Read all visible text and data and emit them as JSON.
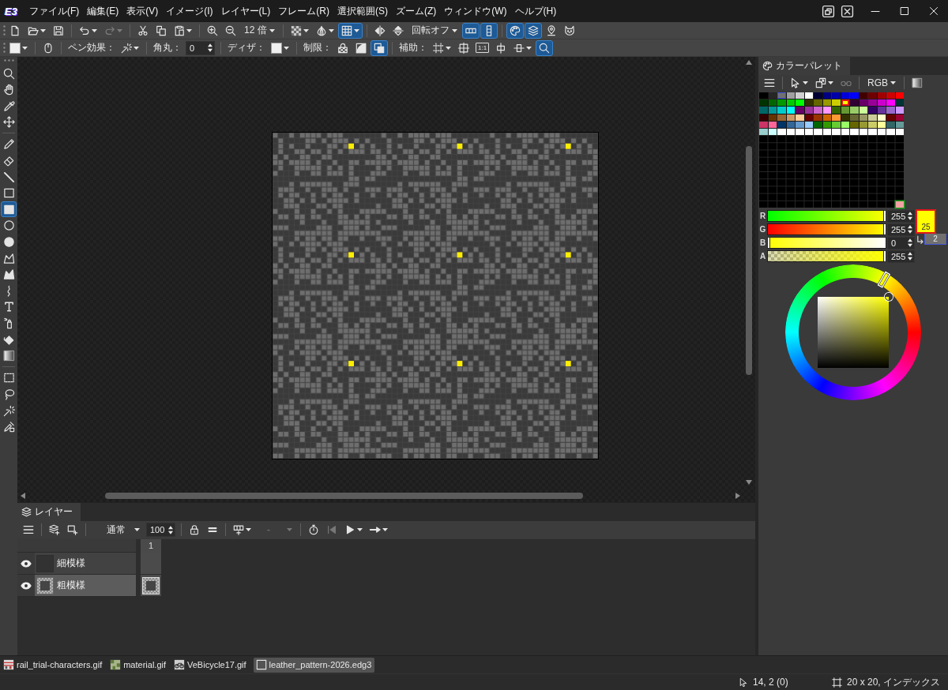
{
  "logo": "E3",
  "menu": [
    "ファイル(F)",
    "編集(E)",
    "表示(V)",
    "イメージ(I)",
    "レイヤー(L)",
    "フレーム(R)",
    "選択範囲(S)",
    "ズーム(Z)",
    "ウィンドウ(W)",
    "ヘルプ(H)"
  ],
  "main_toolbar": {
    "groups": [
      [
        {
          "kind": "icon",
          "on": false,
          "disabled": false,
          "dropdown": false
        },
        {
          "kind": "icon",
          "on": false,
          "disabled": false,
          "dropdown": true
        },
        {
          "kind": "icon",
          "on": false,
          "disabled": false,
          "dropdown": false
        }
      ],
      [
        {
          "kind": "icon",
          "on": false,
          "disabled": false,
          "dropdown": true
        },
        {
          "kind": "icon",
          "on": false,
          "disabled": true,
          "dropdown": true
        }
      ],
      [
        {
          "kind": "icon",
          "on": false,
          "disabled": false,
          "dropdown": false
        },
        {
          "kind": "icon",
          "on": false,
          "disabled": false,
          "dropdown": false
        },
        {
          "kind": "icon",
          "on": false,
          "disabled": false,
          "dropdown": true
        }
      ],
      [
        {
          "kind": "icon",
          "on": false,
          "disabled": false,
          "dropdown": false
        },
        {
          "kind": "icon",
          "on": false,
          "disabled": false,
          "dropdown": false
        },
        {
          "kind": "label",
          "label": "12 倍",
          "on": false,
          "disabled": false,
          "dropdown": true
        }
      ],
      [
        {
          "kind": "icon",
          "on": false,
          "disabled": false,
          "dropdown": true
        },
        {
          "kind": "icon",
          "on": false,
          "disabled": false,
          "dropdown": true
        },
        {
          "kind": "icon",
          "on": true,
          "disabled": false,
          "dropdown": true
        }
      ],
      [
        {
          "kind": "icon",
          "on": false,
          "disabled": false,
          "dropdown": false
        },
        {
          "kind": "icon",
          "on": false,
          "disabled": false,
          "dropdown": false
        },
        {
          "kind": "label",
          "label": "回転オフ",
          "on": false,
          "disabled": false,
          "dropdown": true
        },
        {
          "kind": "icon",
          "on": true,
          "disabled": false,
          "dropdown": false
        },
        {
          "kind": "icon",
          "on": true,
          "disabled": false,
          "dropdown": false
        }
      ],
      [
        {
          "kind": "icon",
          "on": true,
          "disabled": false,
          "dropdown": false
        },
        {
          "kind": "icon",
          "on": true,
          "disabled": false,
          "dropdown": false
        },
        {
          "kind": "icon",
          "on": false,
          "disabled": false,
          "dropdown": false
        },
        {
          "kind": "icon",
          "on": false,
          "disabled": false,
          "dropdown": false
        }
      ]
    ]
  },
  "options_toolbar": {
    "groups": [
      [
        {
          "kind": "swatch",
          "color": "#f0f0f0",
          "dropdown": true
        }
      ],
      [
        {
          "kind": "icon",
          "on": false,
          "dropdown": false
        }
      ],
      [
        {
          "kind": "text",
          "label": "ペン効果："
        },
        {
          "kind": "icon",
          "on": false,
          "dropdown": true
        }
      ],
      [
        {
          "kind": "text",
          "label": "角丸："
        },
        {
          "kind": "field",
          "value": "0"
        }
      ],
      [
        {
          "kind": "text",
          "label": "ディザ："
        },
        {
          "kind": "swatch",
          "color": "#f0f0f0",
          "dropdown": true
        }
      ],
      [
        {
          "kind": "text",
          "label": "制限："
        },
        {
          "kind": "icon",
          "on": false,
          "dropdown": false
        },
        {
          "kind": "icon",
          "on": false,
          "dropdown": false
        },
        {
          "kind": "icon",
          "on": true,
          "dropdown": false
        }
      ],
      [
        {
          "kind": "text",
          "label": "補助："
        },
        {
          "kind": "icon",
          "on": false,
          "dropdown": true
        },
        {
          "kind": "icon",
          "on": false,
          "dropdown": false
        },
        {
          "kind": "badge",
          "label": "1:1",
          "on": false
        },
        {
          "kind": "icon",
          "on": false,
          "dropdown": false
        },
        {
          "kind": "icon",
          "on": false,
          "dropdown": true
        },
        {
          "kind": "icon",
          "on": true,
          "dropdown": false
        }
      ]
    ]
  },
  "toolbox": {
    "groups": [
      [
        {
          "selected": false
        },
        {
          "selected": false
        },
        {
          "selected": false
        },
        {
          "selected": false
        }
      ],
      [
        {
          "selected": false
        },
        {
          "selected": false
        },
        {
          "selected": false
        },
        {
          "selected": false
        },
        {
          "selected": true
        },
        {
          "selected": false
        },
        {
          "selected": false
        },
        {
          "selected": false
        },
        {
          "selected": false
        },
        {
          "selected": false
        },
        {
          "selected": false
        },
        {
          "selected": false
        },
        {
          "selected": false
        },
        {
          "selected": false
        }
      ],
      [
        {
          "selected": false
        },
        {
          "selected": false
        },
        {
          "selected": false
        },
        {
          "selected": false
        }
      ]
    ]
  },
  "layers_panel": {
    "tab": "レイヤー",
    "toolbar": {
      "groups": [
        [
          {
            "kind": "icon",
            "disabled": false,
            "dropdown": false
          }
        ],
        [
          {
            "kind": "icon",
            "disabled": false,
            "dropdown": false
          },
          {
            "kind": "icon",
            "disabled": false,
            "dropdown": false
          }
        ],
        [
          {
            "kind": "select",
            "value": "通常",
            "disabled": false
          },
          {
            "kind": "spin",
            "value": "100"
          }
        ],
        [
          {
            "kind": "icon",
            "disabled": false,
            "dropdown": false
          },
          {
            "kind": "icon",
            "disabled": false,
            "dropdown": false
          }
        ],
        [
          {
            "kind": "icon",
            "disabled": false,
            "dropdown": true
          },
          {
            "kind": "select",
            "value": "-",
            "disabled": true
          }
        ],
        [
          {
            "kind": "icon",
            "disabled": false,
            "dropdown": false
          },
          {
            "kind": "icon",
            "disabled": true,
            "dropdown": false
          },
          {
            "kind": "icon",
            "disabled": false,
            "dropdown": true
          },
          {
            "kind": "icon",
            "disabled": false,
            "dropdown": true
          }
        ]
      ]
    },
    "frames": [
      "1"
    ],
    "layers": [
      {
        "name": "細模様",
        "visible": true,
        "selected": false,
        "empty": true
      },
      {
        "name": "粗模様",
        "visible": true,
        "selected": true,
        "empty": false
      }
    ]
  },
  "palette_panel": {
    "tab": "カラーパレット",
    "toolbar": {
      "groups": [
        [
          {
            "kind": "icon",
            "disabled": false,
            "dropdown": false
          }
        ],
        [
          {
            "kind": "icon",
            "disabled": false,
            "dropdown": true
          },
          {
            "kind": "icon",
            "disabled": false,
            "dropdown": true
          },
          {
            "kind": "icon",
            "disabled": true,
            "dropdown": false
          }
        ],
        [
          {
            "kind": "label",
            "label": "RGB",
            "disabled": false,
            "dropdown": true
          }
        ],
        [
          {
            "kind": "icon",
            "disabled": false,
            "dropdown": false
          }
        ]
      ]
    },
    "swatches": [
      {
        "color": "#000000",
        "selected": false,
        "secondary": false
      },
      {
        "color": "#262626",
        "selected": false,
        "secondary": false
      },
      {
        "color": "#707070",
        "selected": false,
        "secondary": true
      },
      {
        "color": "#a0a0a0",
        "selected": false,
        "secondary": false
      },
      {
        "color": "#d0d0d0",
        "selected": false,
        "secondary": false
      },
      {
        "color": "#ffffff",
        "selected": false,
        "secondary": false
      },
      {
        "color": "#000033",
        "selected": false,
        "secondary": false
      },
      {
        "color": "#000080",
        "selected": false,
        "secondary": false
      },
      {
        "color": "#0000a8",
        "selected": false,
        "secondary": false
      },
      {
        "color": "#0000d8",
        "selected": false,
        "secondary": false
      },
      {
        "color": "#0000ff",
        "selected": false,
        "secondary": false
      },
      {
        "color": "#400000",
        "selected": false,
        "secondary": false
      },
      {
        "color": "#700000",
        "selected": false,
        "secondary": false
      },
      {
        "color": "#a00000",
        "selected": false,
        "secondary": false
      },
      {
        "color": "#d00000",
        "selected": false,
        "secondary": false
      },
      {
        "color": "#ff0000",
        "selected": false,
        "secondary": false
      },
      {
        "color": "#003300",
        "selected": false,
        "secondary": false
      },
      {
        "color": "#006600",
        "selected": false,
        "secondary": false
      },
      {
        "color": "#009900",
        "selected": false,
        "secondary": false
      },
      {
        "color": "#00cc00",
        "selected": false,
        "secondary": false
      },
      {
        "color": "#00ff00",
        "selected": false,
        "secondary": false
      },
      {
        "color": "#333300",
        "selected": false,
        "secondary": false
      },
      {
        "color": "#666600",
        "selected": false,
        "secondary": false
      },
      {
        "color": "#999900",
        "selected": false,
        "secondary": false
      },
      {
        "color": "#cccc00",
        "selected": false,
        "secondary": false
      },
      {
        "color": "#ffff00",
        "selected": true,
        "secondary": false
      },
      {
        "color": "#330033",
        "selected": false,
        "secondary": false
      },
      {
        "color": "#660066",
        "selected": false,
        "secondary": false
      },
      {
        "color": "#990099",
        "selected": false,
        "secondary": false
      },
      {
        "color": "#cc00cc",
        "selected": false,
        "secondary": false
      },
      {
        "color": "#ff00ff",
        "selected": false,
        "secondary": false
      },
      {
        "color": "#003333",
        "selected": false,
        "secondary": false
      },
      {
        "color": "#006666",
        "selected": false,
        "secondary": false
      },
      {
        "color": "#009999",
        "selected": false,
        "secondary": false
      },
      {
        "color": "#00cccc",
        "selected": false,
        "secondary": false
      },
      {
        "color": "#00ffff",
        "selected": false,
        "secondary": false
      },
      {
        "color": "#660066",
        "selected": false,
        "secondary": false
      },
      {
        "color": "#993399",
        "selected": false,
        "secondary": false
      },
      {
        "color": "#cc66cc",
        "selected": false,
        "secondary": false
      },
      {
        "color": "#ff99ff",
        "selected": false,
        "secondary": false
      },
      {
        "color": "#336600",
        "selected": false,
        "secondary": false
      },
      {
        "color": "#669933",
        "selected": false,
        "secondary": false
      },
      {
        "color": "#99cc66",
        "selected": false,
        "secondary": false
      },
      {
        "color": "#ccff99",
        "selected": false,
        "secondary": false
      },
      {
        "color": "#330066",
        "selected": false,
        "secondary": false
      },
      {
        "color": "#663399",
        "selected": false,
        "secondary": false
      },
      {
        "color": "#9966cc",
        "selected": false,
        "secondary": false
      },
      {
        "color": "#cc99ff",
        "selected": false,
        "secondary": false
      },
      {
        "color": "#330000",
        "selected": false,
        "secondary": false
      },
      {
        "color": "#663300",
        "selected": false,
        "secondary": false
      },
      {
        "color": "#996633",
        "selected": false,
        "secondary": false
      },
      {
        "color": "#cc9966",
        "selected": false,
        "secondary": false
      },
      {
        "color": "#ffcc99",
        "selected": false,
        "secondary": false
      },
      {
        "color": "#660000",
        "selected": false,
        "secondary": false
      },
      {
        "color": "#993300",
        "selected": false,
        "secondary": false
      },
      {
        "color": "#cc6600",
        "selected": false,
        "secondary": false
      },
      {
        "color": "#ff9933",
        "selected": false,
        "secondary": false
      },
      {
        "color": "#333300",
        "selected": false,
        "secondary": false
      },
      {
        "color": "#666633",
        "selected": false,
        "secondary": false
      },
      {
        "color": "#999966",
        "selected": false,
        "secondary": false
      },
      {
        "color": "#cccc99",
        "selected": false,
        "secondary": false
      },
      {
        "color": "#ffffcc",
        "selected": false,
        "secondary": false
      },
      {
        "color": "#660000",
        "selected": false,
        "secondary": false
      },
      {
        "color": "#990033",
        "selected": false,
        "secondary": false
      },
      {
        "color": "#cc3366",
        "selected": false,
        "secondary": false
      },
      {
        "color": "#ff6699",
        "selected": false,
        "secondary": false
      },
      {
        "color": "#003366",
        "selected": false,
        "secondary": false
      },
      {
        "color": "#336699",
        "selected": false,
        "secondary": false
      },
      {
        "color": "#6699cc",
        "selected": false,
        "secondary": false
      },
      {
        "color": "#99ccff",
        "selected": false,
        "secondary": false
      },
      {
        "color": "#006600",
        "selected": false,
        "secondary": false
      },
      {
        "color": "#339900",
        "selected": false,
        "secondary": false
      },
      {
        "color": "#66cc33",
        "selected": false,
        "secondary": false
      },
      {
        "color": "#99ff66",
        "selected": false,
        "secondary": false
      },
      {
        "color": "#666600",
        "selected": false,
        "secondary": false
      },
      {
        "color": "#999933",
        "selected": false,
        "secondary": false
      },
      {
        "color": "#cccc66",
        "selected": false,
        "secondary": false
      },
      {
        "color": "#ffff99",
        "selected": false,
        "secondary": false
      },
      {
        "color": "#336666",
        "selected": false,
        "secondary": false
      },
      {
        "color": "#669999",
        "selected": false,
        "secondary": false
      },
      {
        "color": "#99cccc",
        "selected": false,
        "secondary": false
      },
      {
        "color": "#ccffff",
        "selected": false,
        "secondary": false
      },
      {
        "color": "#ffffff",
        "selected": false,
        "secondary": false
      },
      {
        "color": "#ffffff",
        "selected": false,
        "secondary": false
      },
      {
        "color": "#ffffff",
        "selected": false,
        "secondary": false
      },
      {
        "color": "#ffffff",
        "selected": false,
        "secondary": false
      },
      {
        "color": "#ffffff",
        "selected": false,
        "secondary": false
      },
      {
        "color": "#ffffff",
        "selected": false,
        "secondary": false
      },
      {
        "color": "#ffffff",
        "selected": false,
        "secondary": false
      },
      {
        "color": "#ffffff",
        "selected": false,
        "secondary": false
      },
      {
        "color": "#ffffff",
        "selected": false,
        "secondary": false
      },
      {
        "color": "#ffffff",
        "selected": false,
        "secondary": false
      },
      {
        "color": "#ffffff",
        "selected": false,
        "secondary": false
      },
      {
        "color": "#ffffff",
        "selected": false,
        "secondary": false
      },
      {
        "color": "#ffffff",
        "selected": false,
        "secondary": false
      },
      {
        "color": "#ffffff",
        "selected": false,
        "secondary": false
      }
    ],
    "transparent_swatch": {
      "color": "#f2a2a2"
    },
    "channels": [
      {
        "kind": "color",
        "name": "R",
        "level": 1,
        "reading": "255"
      },
      {
        "kind": "color",
        "name": "G",
        "level": 1,
        "reading": "255"
      },
      {
        "kind": "color",
        "name": "B",
        "level": 0,
        "reading": "0"
      },
      {
        "kind": "alpha",
        "name": "A",
        "level": 1,
        "reading": "255"
      }
    ],
    "foreground": {
      "label": "25",
      "color": "#ffff00"
    },
    "background": {
      "label": "2",
      "color": "#707070"
    }
  },
  "file_tabs": [
    {
      "name": "rail_trial-characters.gif",
      "selected": false
    },
    {
      "name": "material.gif",
      "selected": false
    },
    {
      "name": "VeBicycle17.gif",
      "selected": false
    },
    {
      "name": "leather_pattern-2026.edg3",
      "selected": true
    }
  ],
  "status_bar": {
    "cursor": "14, 2 (0)",
    "image_info": "20 x 20, インデックス"
  }
}
